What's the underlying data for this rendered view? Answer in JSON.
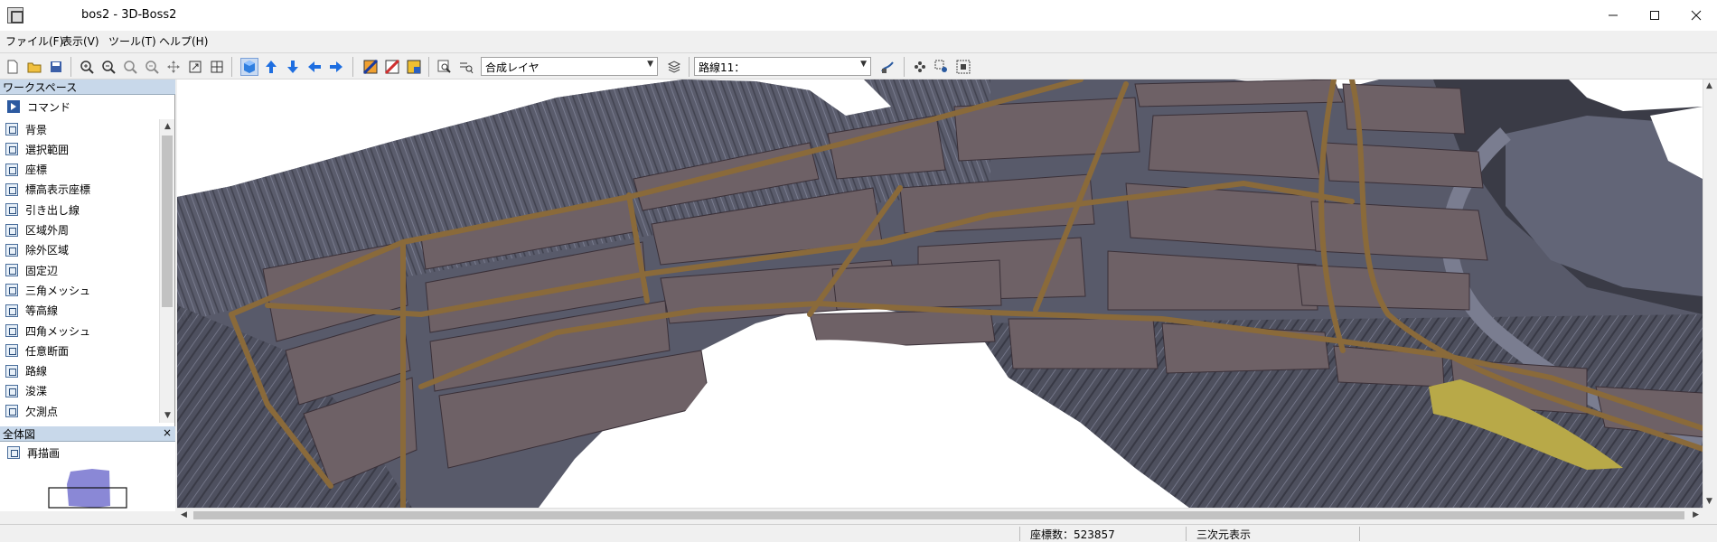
{
  "window": {
    "title": "bos2 - 3D-Boss2"
  },
  "menu": [
    "ファイル(F)",
    "表示(V)",
    "ツール(T)",
    "ヘルプ(H)"
  ],
  "toolbar": {
    "layer_combo": "合成レイヤ",
    "route_combo": "路線11："
  },
  "workspace": {
    "header": "ワークスペース",
    "command_label": "コマンド",
    "items": [
      "背景",
      "選択範囲",
      "座標",
      "標高表示座標",
      "引き出し線",
      "区域外周",
      "除外区域",
      "固定辺",
      "三角メッシュ",
      "等高線",
      "四角メッシュ",
      "任意断面",
      "路線",
      "浚渫",
      "欠測点"
    ]
  },
  "overview": {
    "header": "全体図",
    "redraw_label": "再描画",
    "close_symbol": "×"
  },
  "status": {
    "coord_count": "座標数：523857",
    "mode": "三次元表示"
  },
  "colors": {
    "terrain": "#585a6a",
    "plot_fill": "#6e6166",
    "road": "#8a6a3a",
    "highlight": "#b8a948",
    "overview_shape": "#8a88d6"
  }
}
